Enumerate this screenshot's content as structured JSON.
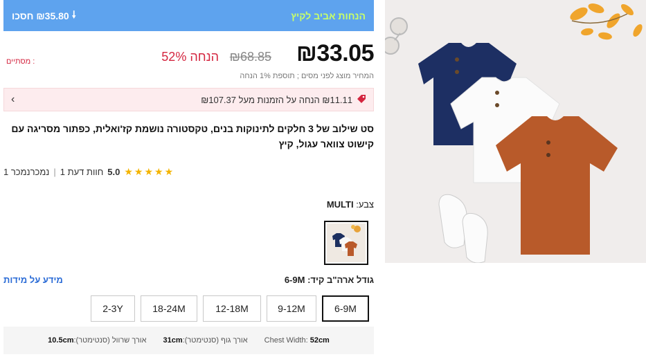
{
  "promo": {
    "save_text": "₪35.80 חסכו",
    "arrow_icon": "arrow-down-icon",
    "campaign": "הנחות אביב לקיץ"
  },
  "price": {
    "current": "₪33.05",
    "original": "₪68.85",
    "discount": "52% הנחה",
    "side_label": "מסתיים :",
    "tax_note": "המחיר מוצג לפני מסים ; תוספת 1% הנחה"
  },
  "coupon": {
    "text": "₪11.11 הנחה על הזמנות מעל ₪107.37",
    "tag_icon": "price-tag-icon",
    "chevron": "‹"
  },
  "product": {
    "title": "סט שילוב של 3 חלקים לתינוקות בנים, טקסטורה נושמת קז'ואלית, כפתור מסריגה עם קישוט צוואר עגול, קיץ"
  },
  "rating": {
    "score": "5.0",
    "stars": "★★★★★",
    "reviews": "חוות דעת 1",
    "recommended": "נמכרנמכר 1"
  },
  "color": {
    "label": "צבע:",
    "value": "MULTI"
  },
  "size": {
    "label": "גודל ארה\"ב קיד:",
    "value": "6-9M",
    "guide_link": "מידע על מידות",
    "options": [
      "6-9M",
      "9-12M",
      "12-18M",
      "18-24M",
      "2-3Y"
    ],
    "selected": "6-9M"
  },
  "measurements": {
    "chest_label": "Chest Width:",
    "chest_value": "52cm",
    "length_label": "אורך גוף (סנטימטר):",
    "length_value": "31cm",
    "sleeve_label": "אורך שרוול (סנטימטר):",
    "sleeve_value": "10.5cm"
  },
  "colors": {
    "accent_blue": "#5ea3ee",
    "sale_red": "#d4253f",
    "coupon_bg": "#fdecee",
    "star": "#f4b400",
    "link_blue": "#2a6bd6"
  }
}
